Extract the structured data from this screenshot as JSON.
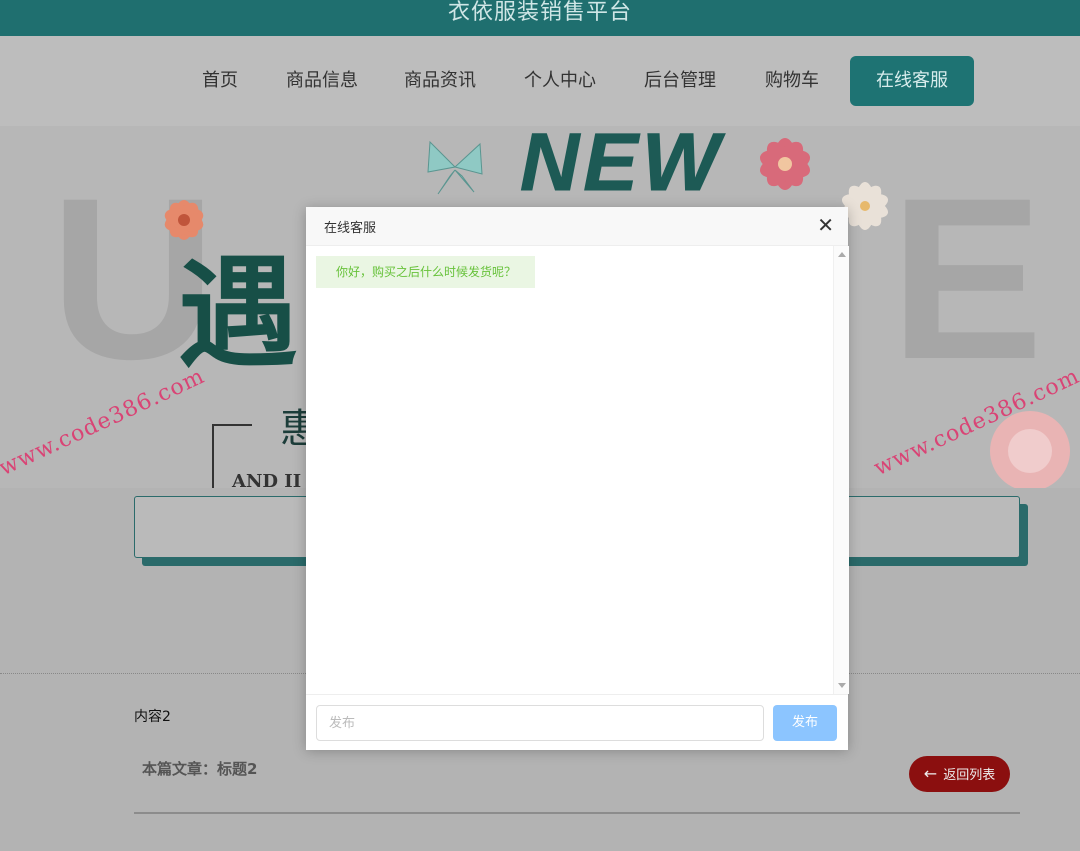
{
  "header": {
    "title": "衣依服装销售平台"
  },
  "nav": {
    "items": [
      {
        "label": "首页"
      },
      {
        "label": "商品信息"
      },
      {
        "label": "商品资讯"
      },
      {
        "label": "个人中心"
      },
      {
        "label": "后台管理"
      },
      {
        "label": "购物车"
      }
    ],
    "active_label": "在线客服"
  },
  "banner": {
    "new_text": "NEW",
    "big_char": "遇",
    "sub_char": "惠",
    "english_text": "AND II"
  },
  "article": {
    "content_label": "内容2",
    "title_line": "本篇文章：标题2",
    "back_label": "返回列表"
  },
  "watermark": {
    "text": "www.code386.com"
  },
  "chat_modal": {
    "title": "在线客服",
    "messages": [
      {
        "text": "你好，购买之后什么时候发货呢？"
      }
    ],
    "input_placeholder": "发布",
    "send_label": "发布"
  },
  "colors": {
    "brand_teal": "#1f6f6f",
    "back_button": "#8b0f0f",
    "send_button": "#8cc5ff",
    "message_bg": "#eaf6e3",
    "message_text": "#67c23a"
  }
}
